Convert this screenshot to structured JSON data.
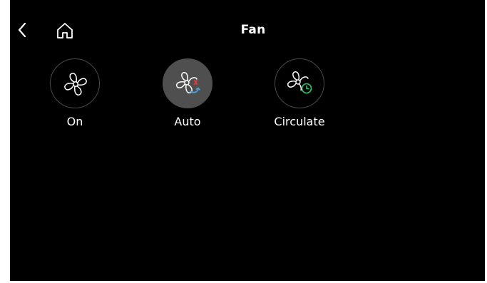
{
  "header": {
    "title": "Fan",
    "back_icon": "chevron-left-icon",
    "home_icon": "home-icon"
  },
  "fan_modes": [
    {
      "label": "On",
      "icon": "fan-icon",
      "selected": false
    },
    {
      "label": "Auto",
      "icon": "fan-auto-icon",
      "selected": true
    },
    {
      "label": "Circulate",
      "icon": "fan-circulate-icon",
      "selected": false
    }
  ],
  "colors": {
    "background": "#000000",
    "selected_circle": "#4f4f4f",
    "auto_red": "#e53935",
    "auto_blue": "#4aa3e0",
    "circulate_green": "#2ecc71"
  }
}
